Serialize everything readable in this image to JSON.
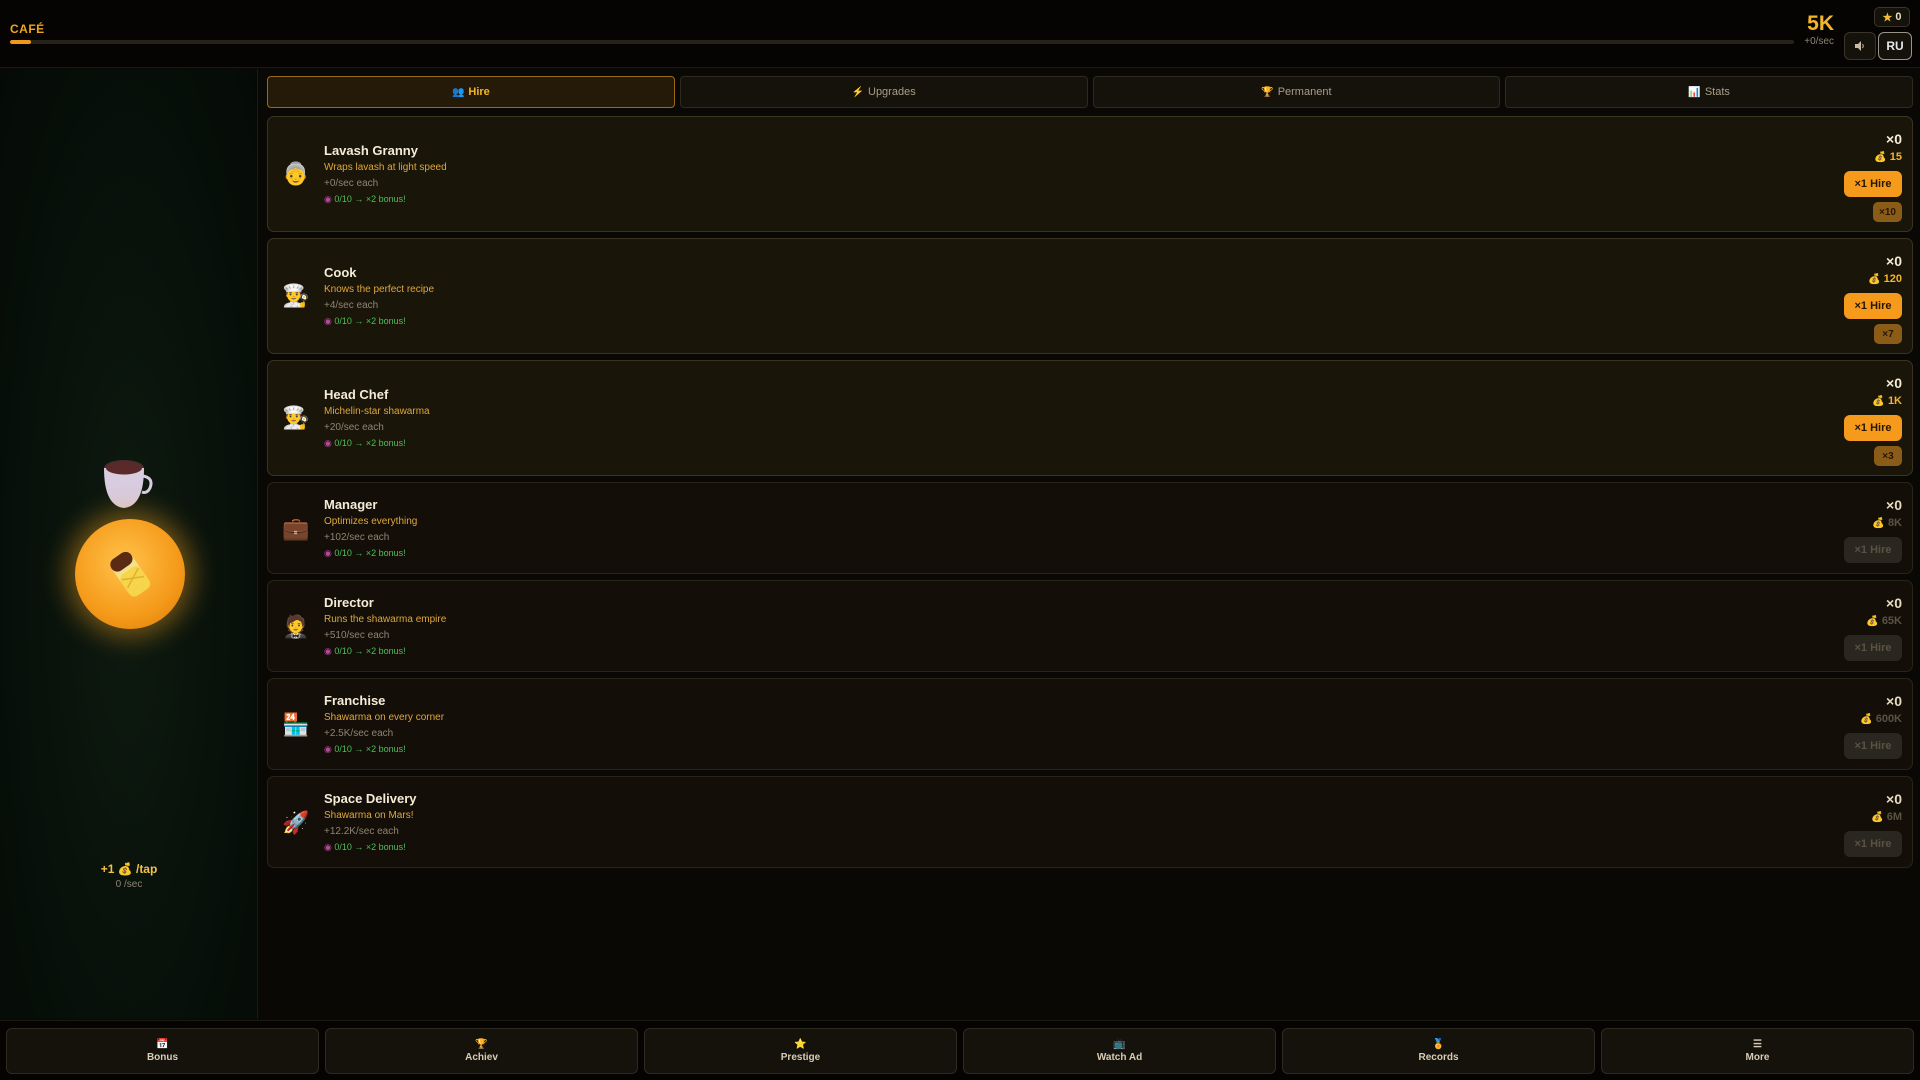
{
  "header": {
    "brand": "CAFÉ",
    "progress_fraction": 0.012,
    "balance": "5K",
    "balance_rate": "+0/sec",
    "stars": "0",
    "lang": "RU"
  },
  "tap_panel": {
    "per_tap": "+1 💰 /tap",
    "per_sec": "0 /sec"
  },
  "tabs": [
    {
      "label": "Hire",
      "icon": "👥",
      "active": true
    },
    {
      "label": "Upgrades",
      "icon": "⚡",
      "active": false
    },
    {
      "label": "Permanent",
      "icon": "🏆",
      "active": false
    },
    {
      "label": "Stats",
      "icon": "📊",
      "active": false
    }
  ],
  "hires": [
    {
      "name": "Lavash Granny",
      "desc": "Wraps lavash at light speed",
      "rate": "+0/sec each",
      "bonus": "0/10 → ×2 bonus!",
      "count": "×0",
      "price": "15",
      "hire": "×1 Hire",
      "multi": "×10",
      "affordable": true,
      "avatar": "👵"
    },
    {
      "name": "Cook",
      "desc": "Knows the perfect recipe",
      "rate": "+4/sec each",
      "bonus": "0/10 → ×2 bonus!",
      "count": "×0",
      "price": "120",
      "hire": "×1 Hire",
      "multi": "×7",
      "affordable": true,
      "avatar": "👨‍🍳"
    },
    {
      "name": "Head Chef",
      "desc": "Michelin-star shawarma",
      "rate": "+20/sec each",
      "bonus": "0/10 → ×2 bonus!",
      "count": "×0",
      "price": "1K",
      "hire": "×1 Hire",
      "multi": "×3",
      "affordable": true,
      "avatar": "👨‍🍳"
    },
    {
      "name": "Manager",
      "desc": "Optimizes everything",
      "rate": "+102/sec each",
      "bonus": "0/10 → ×2 bonus!",
      "count": "×0",
      "price": "8K",
      "hire": "×1 Hire",
      "multi": "",
      "affordable": false,
      "avatar": "💼"
    },
    {
      "name": "Director",
      "desc": "Runs the shawarma empire",
      "rate": "+510/sec each",
      "bonus": "0/10 → ×2 bonus!",
      "count": "×0",
      "price": "65K",
      "hire": "×1 Hire",
      "multi": "",
      "affordable": false,
      "avatar": "🤵"
    },
    {
      "name": "Franchise",
      "desc": "Shawarma on every corner",
      "rate": "+2.5K/sec each",
      "bonus": "0/10 → ×2 bonus!",
      "count": "×0",
      "price": "600K",
      "hire": "×1 Hire",
      "multi": "",
      "affordable": false,
      "avatar": "🏪"
    },
    {
      "name": "Space Delivery",
      "desc": "Shawarma on Mars!",
      "rate": "+12.2K/sec each",
      "bonus": "0/10 → ×2 bonus!",
      "count": "×0",
      "price": "6M",
      "hire": "×1 Hire",
      "multi": "",
      "affordable": false,
      "avatar": "🚀"
    }
  ],
  "bottom_nav": [
    {
      "label": "Bonus",
      "icon": "📅"
    },
    {
      "label": "Achiev",
      "icon": "🏆"
    },
    {
      "label": "Prestige",
      "icon": "⭐"
    },
    {
      "label": "Watch Ad",
      "icon": "📺"
    },
    {
      "label": "Records",
      "icon": "🏅"
    },
    {
      "label": "More",
      "icon": "☰"
    }
  ],
  "colors": {
    "accent": "#f59a1a",
    "gold_text": "#f5b52a",
    "bonus_green": "#4fbf5a",
    "background": "#0a0804"
  }
}
